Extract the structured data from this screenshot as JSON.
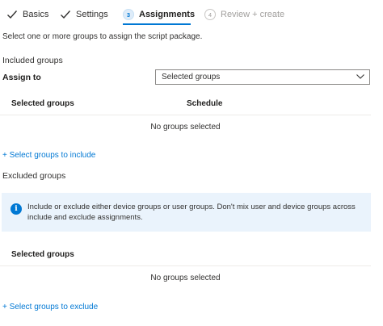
{
  "wizard": {
    "steps": [
      {
        "label": "Basics",
        "state": "done"
      },
      {
        "label": "Settings",
        "state": "done"
      },
      {
        "label": "Assignments",
        "state": "active",
        "number": "3"
      },
      {
        "label": "Review + create",
        "state": "pending",
        "number": "4"
      }
    ]
  },
  "description": "Select one or more groups to assign the script package.",
  "included": {
    "title": "Included groups",
    "assign_to_label": "Assign to",
    "assign_to_value": "Selected groups",
    "columns": [
      "Selected groups",
      "Schedule"
    ],
    "empty_text": "No groups selected",
    "add_link": "+ Select groups to include"
  },
  "excluded": {
    "title": "Excluded groups",
    "info_text": "Include or exclude either device groups or user groups. Don't mix user and device groups across include and exclude assignments.",
    "columns": [
      "Selected groups"
    ],
    "empty_text": "No groups selected",
    "add_link": "+ Select groups to exclude"
  },
  "colors": {
    "accent": "#0078d4",
    "info_background": "#eaf3fc",
    "text": "#323130",
    "disabled": "#a19f9d"
  },
  "icons": [
    "checkmark-icon",
    "info-icon",
    "chevron-down-icon"
  ]
}
